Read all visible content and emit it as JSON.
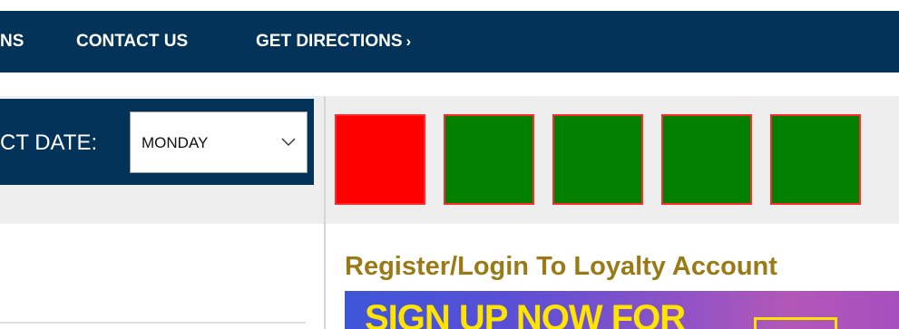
{
  "nav": {
    "items": [
      {
        "label": "NS"
      },
      {
        "label": "CONTACT US"
      },
      {
        "label": "GET DIRECTIONS"
      }
    ],
    "directions_arrow": "›"
  },
  "date_picker": {
    "label": "CT DATE:",
    "selected": "MONDAY"
  },
  "days": [
    {
      "color": "#ff0000"
    },
    {
      "color": "#007f00"
    },
    {
      "color": "#007f00"
    },
    {
      "color": "#007f00"
    },
    {
      "color": "#007f00"
    }
  ],
  "loyalty": {
    "title": "Register/Login To Loyalty Account",
    "promo_text": "SIGN UP NOW FOR"
  },
  "colors": {
    "nav_bg": "#04335a",
    "title_gold": "#9a7a16",
    "promo_yellow": "#ffe400"
  }
}
